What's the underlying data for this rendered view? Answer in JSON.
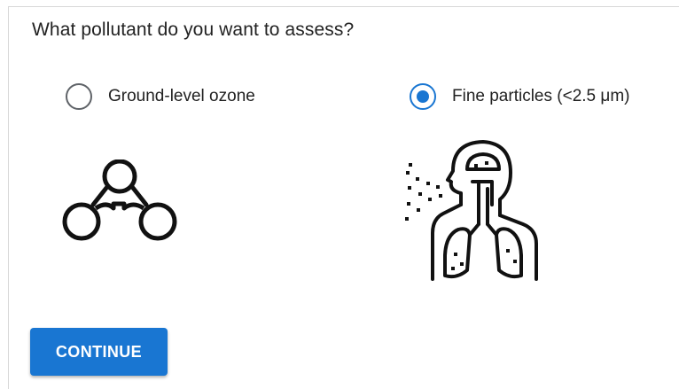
{
  "question": "What pollutant do you want to assess?",
  "options": [
    {
      "label": "Ground-level ozone",
      "selected": false,
      "icon": "ozone-molecule-icon"
    },
    {
      "label": "Fine particles (<2.5 μm)",
      "selected": true,
      "icon": "lungs-particles-icon"
    }
  ],
  "continue_label": "CONTINUE",
  "colors": {
    "accent": "#1976d2",
    "text": "#222222",
    "radio_unchecked": "#5f6368",
    "icon": "#111111"
  }
}
